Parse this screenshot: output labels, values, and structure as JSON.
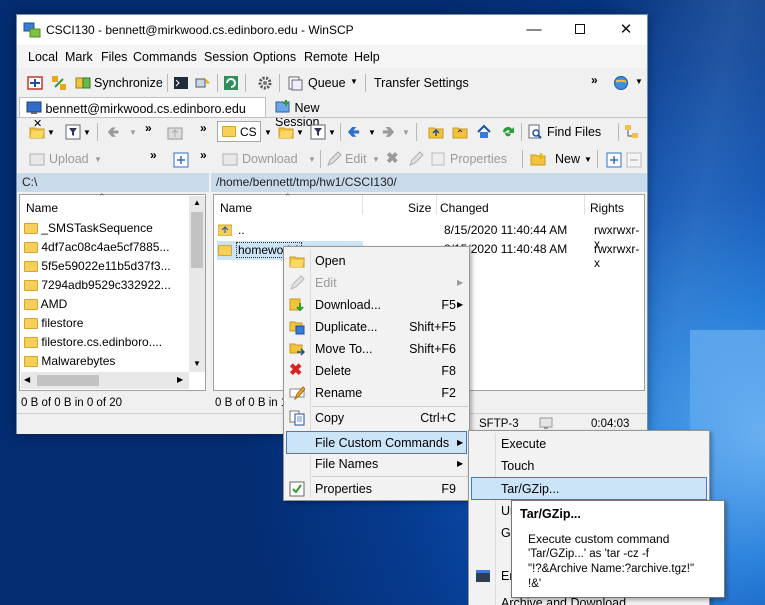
{
  "window": {
    "title": "CSCI130 - bennett@mirkwood.cs.edinboro.edu - WinSCP"
  },
  "menu": [
    "Local",
    "Mark",
    "Files",
    "Commands",
    "Session",
    "Options",
    "Remote",
    "Help"
  ],
  "toolbar": {
    "synchronize": "Synchronize",
    "queue": "Queue",
    "transfer_settings": "Transfer Settings"
  },
  "tabs": {
    "session": "bennett@mirkwood.cs.edinboro.edu",
    "new_session": "New Session"
  },
  "left_toolbar": {
    "drive": "C:",
    "upload": "Upload"
  },
  "right_toolbar": {
    "dir": "CS",
    "find_files": "Find Files",
    "download": "Download",
    "edit": "Edit",
    "properties": "Properties",
    "new": "New"
  },
  "left_panel": {
    "path": "C:\\",
    "col_name": "Name",
    "items": [
      "_SMSTaskSequence",
      "4df7ac08c4ae5cf7885...",
      "5f5e59022e11b5d37f3...",
      "7294adb9529c332922...",
      "AMD",
      "filestore",
      "filestore.cs.edinboro....",
      "Malwarebytes"
    ],
    "status": "0 B of 0 B in 0 of 20"
  },
  "right_panel": {
    "path": "/home/bennett/tmp/hw1/CSCI130/",
    "col_name": "Name",
    "col_size": "Size",
    "col_changed": "Changed",
    "col_rights": "Rights",
    "rows": [
      {
        "name": "..",
        "changed": "8/15/2020 11:40:44 AM",
        "rights": "rwxrwxr-x"
      },
      {
        "name": "homework1",
        "changed": "8/15/2020 11:40:48 AM",
        "rights": "rwxrwxr-x"
      }
    ],
    "status": "0 B of 0 B in 1"
  },
  "statusbar": {
    "protocol": "SFTP-3",
    "time": "0:04:03"
  },
  "context_menu": {
    "open": "Open",
    "edit": "Edit",
    "download": "Download...",
    "download_sc": "F5",
    "duplicate": "Duplicate...",
    "duplicate_sc": "Shift+F5",
    "move": "Move To...",
    "move_sc": "Shift+F6",
    "delete": "Delete",
    "delete_sc": "F8",
    "rename": "Rename",
    "rename_sc": "F2",
    "copy": "Copy",
    "copy_sc": "Ctrl+C",
    "custom": "File Custom Commands",
    "file_names": "File Names",
    "properties": "Properties",
    "properties_sc": "F9"
  },
  "submenu": {
    "execute": "Execute",
    "touch": "Touch",
    "tar": "Tar/GZip...",
    "u": "Ur",
    "g": "Gr",
    "e": "En",
    "archive_download": "Archive and Download..."
  },
  "tooltip": {
    "title": "Tar/GZip...",
    "line1": "Execute custom command",
    "line2": "'Tar/GZip...' as 'tar -cz  -f",
    "line3": "\"!?&Archive Name:?archive.tgz!\"",
    "line4": "!&'"
  }
}
